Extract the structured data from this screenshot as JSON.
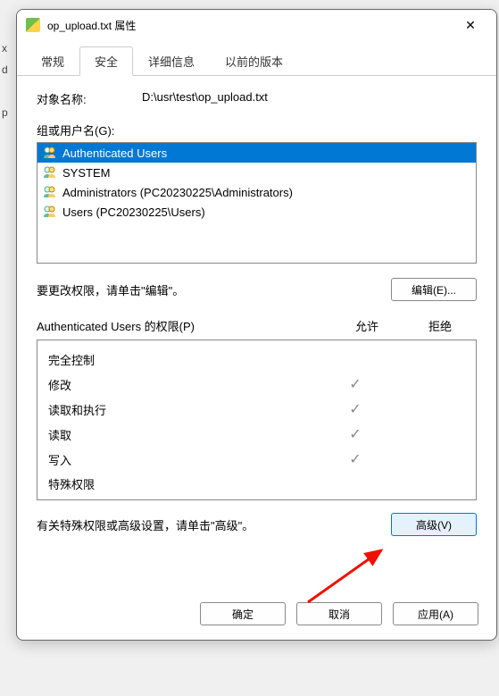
{
  "window": {
    "title": "op_upload.txt 属性",
    "close": "✕"
  },
  "tabs": [
    {
      "label": "常规",
      "active": false
    },
    {
      "label": "安全",
      "active": true
    },
    {
      "label": "详细信息",
      "active": false
    },
    {
      "label": "以前的版本",
      "active": false
    }
  ],
  "object": {
    "label": "对象名称:",
    "value": "D:\\usr\\test\\op_upload.txt"
  },
  "groups_label": "组或用户名(G):",
  "groups": [
    {
      "name": "Authenticated Users",
      "selected": true
    },
    {
      "name": "SYSTEM",
      "selected": false
    },
    {
      "name": "Administrators (PC20230225\\Administrators)",
      "selected": false
    },
    {
      "name": "Users (PC20230225\\Users)",
      "selected": false
    }
  ],
  "edit_hint": "要更改权限，请单击\"编辑\"。",
  "edit_btn": "编辑(E)...",
  "perm_title_prefix": "Authenticated Users 的权限(P)",
  "perm_cols": {
    "allow": "允许",
    "deny": "拒绝"
  },
  "perms": [
    {
      "name": "完全控制",
      "allow": false,
      "deny": false
    },
    {
      "name": "修改",
      "allow": true,
      "deny": false
    },
    {
      "name": "读取和执行",
      "allow": true,
      "deny": false
    },
    {
      "name": "读取",
      "allow": true,
      "deny": false
    },
    {
      "name": "写入",
      "allow": true,
      "deny": false
    },
    {
      "name": "特殊权限",
      "allow": false,
      "deny": false
    }
  ],
  "adv_hint": "有关特殊权限或高级设置，请单击\"高级\"。",
  "adv_btn": "高级(V)",
  "footer": {
    "ok": "确定",
    "cancel": "取消",
    "apply": "应用(A)"
  }
}
